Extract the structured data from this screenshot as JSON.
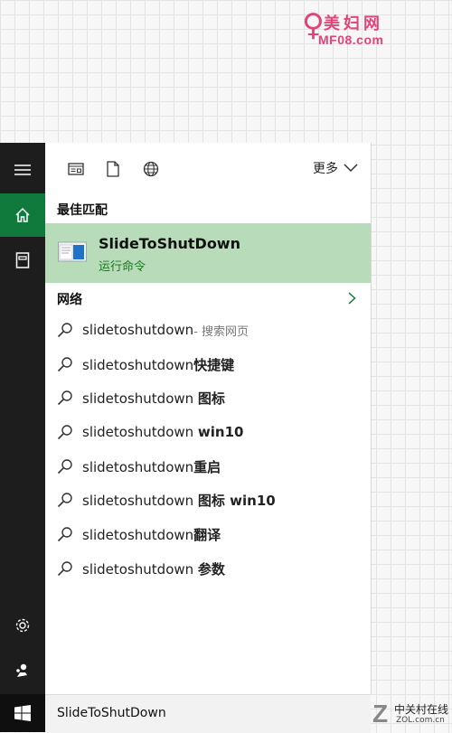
{
  "watermark_top": {
    "cn": "美妇网",
    "en": "MF08.com"
  },
  "watermark_bottom": {
    "z": "Z",
    "cn": "中关村在线",
    "en": "ZOL.com.cn"
  },
  "toolbar": {
    "more_label": "更多"
  },
  "best_match": {
    "header": "最佳匹配",
    "title": "SlideToShutDown",
    "subtitle": "运行命令"
  },
  "network": {
    "header": "网络"
  },
  "suggestions": [
    {
      "text": "slidetoshutdown",
      "bold": "",
      "hint": " - 搜索网页"
    },
    {
      "text": "slidetoshutdown",
      "bold": "快捷键",
      "hint": ""
    },
    {
      "text": "slidetoshutdown ",
      "bold": "图标",
      "hint": ""
    },
    {
      "text": "slidetoshutdown ",
      "bold": "win10",
      "hint": ""
    },
    {
      "text": "slidetoshutdown",
      "bold": "重启",
      "hint": ""
    },
    {
      "text": "slidetoshutdown ",
      "bold": "图标 win10",
      "hint": ""
    },
    {
      "text": "slidetoshutdown",
      "bold": "翻译",
      "hint": ""
    },
    {
      "text": "slidetoshutdown ",
      "bold": "参数",
      "hint": ""
    }
  ],
  "search": {
    "value": "SlideToShutDown"
  },
  "colors": {
    "accent": "#0f7a3c",
    "best_bg": "#b8dcb9",
    "rail": "#1d1d1d"
  },
  "rail_icons": [
    "hamburger-icon",
    "home-icon",
    "notebook-icon",
    "gear-icon",
    "feedback-icon",
    "windows-logo-icon"
  ]
}
